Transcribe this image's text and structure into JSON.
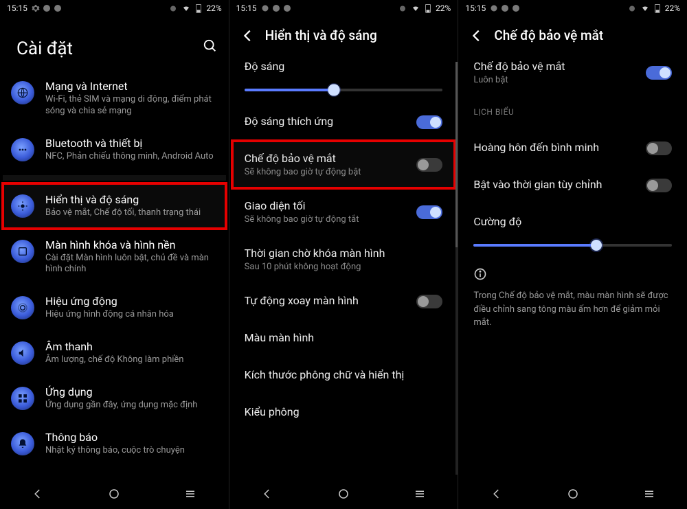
{
  "status": {
    "time": "15:15",
    "battery": "22%"
  },
  "panel1": {
    "title": "Cài đặt",
    "items": [
      {
        "title": "Mạng và Internet",
        "sub": "Wi-Fi, thẻ SIM và mạng di động, điểm phát sóng và chia sẻ mạng"
      },
      {
        "title": "Bluetooth và thiết bị",
        "sub": "NFC, Phản chiếu thông minh, Android Auto"
      },
      {
        "title": "Hiển thị và độ sáng",
        "sub": "Bảo vệ mắt, Chế độ tối, thanh trạng thái",
        "highlight": true
      },
      {
        "title": "Màn hình khóa và hình nền",
        "sub": "Cài đặt Màn hình luôn bật, chủ đề và màn hình chính"
      },
      {
        "title": "Hiệu ứng động",
        "sub": "Hiệu ứng hình động cá nhân hóa"
      },
      {
        "title": "Âm thanh",
        "sub": "Âm lượng, chế độ Không làm phiền"
      },
      {
        "title": "Ứng dụng",
        "sub": "Ứng dụng gần đây, ứng dụng mặc định"
      },
      {
        "title": "Thông báo",
        "sub": "Nhật ký thông báo, cuộc trò chuyện"
      }
    ]
  },
  "panel2": {
    "title": "Hiển thị và độ sáng",
    "brightness_label": "Độ sáng",
    "brightness_value": 45,
    "rows": [
      {
        "title": "Độ sáng thích ứng",
        "toggle": "on"
      },
      {
        "title": "Chế độ bảo vệ mắt",
        "sub": "Sẽ không bao giờ tự động bật",
        "toggle": "off",
        "highlight": true
      },
      {
        "title": "Giao diện tối",
        "sub": "Sẽ không bao giờ tự động tắt",
        "toggle": "on"
      },
      {
        "title": "Thời gian chờ khóa màn hình",
        "sub": "Sau 10 phút không hoạt động"
      },
      {
        "title": "Tự động xoay màn hình",
        "toggle": "off"
      },
      {
        "title": "Màu màn hình"
      },
      {
        "title": "Kích thước phông chữ và hiển thị"
      },
      {
        "title": "Kiểu phông"
      }
    ]
  },
  "panel3": {
    "title": "Chế độ bảo vệ mắt",
    "main": {
      "title": "Chế độ bảo vệ mắt",
      "sub": "Luôn bật",
      "toggle": "on"
    },
    "section_label": "LỊCH BIỂU",
    "rows": [
      {
        "title": "Hoàng hôn đến bình minh",
        "toggle": "off"
      },
      {
        "title": "Bật vào thời gian tùy chỉnh",
        "toggle": "off"
      }
    ],
    "intensity_label": "Cường độ",
    "intensity_value": 62,
    "info": "Trong Chế độ bảo vệ mắt, màu màn hình sẽ được điều chỉnh sang tông màu ấm hơn để giảm mỏi mắt."
  }
}
